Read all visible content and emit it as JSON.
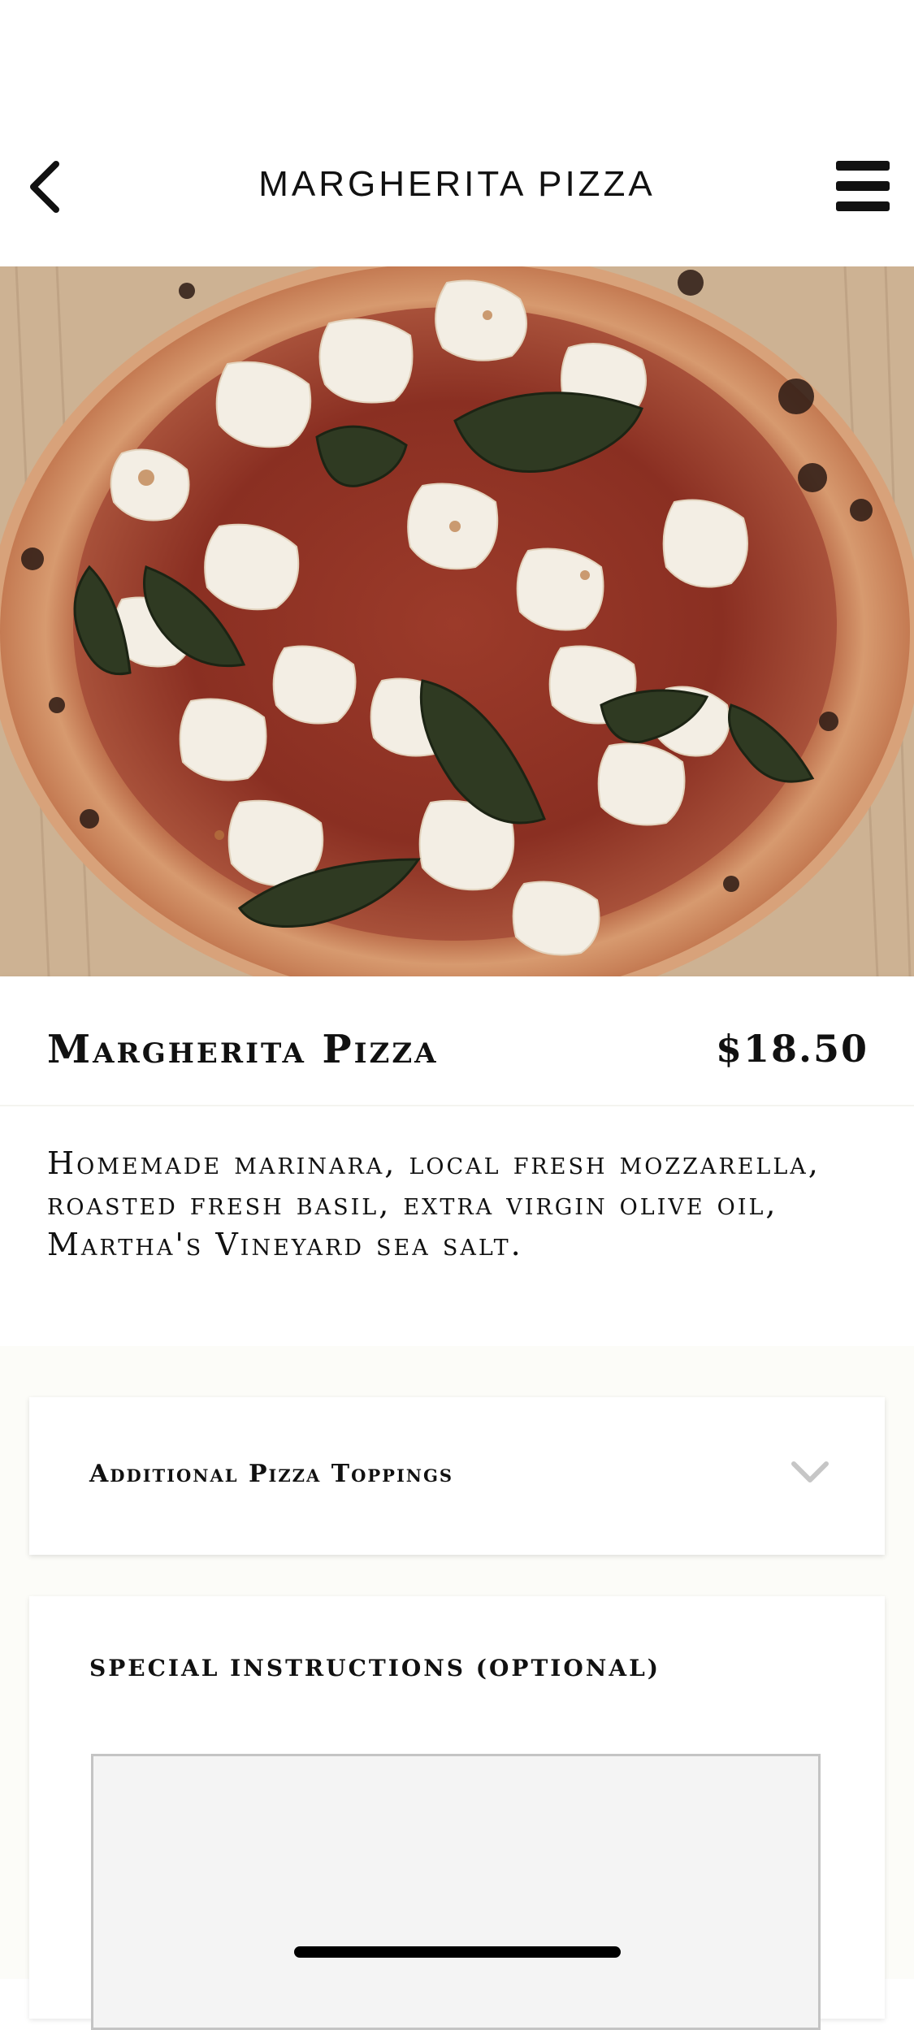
{
  "header": {
    "title": "MARGHERITA PIZZA",
    "back_icon": "chevron-left-icon",
    "menu_icon": "hamburger-menu-icon"
  },
  "hero": {
    "image": "margherita-pizza-photo"
  },
  "product": {
    "name": "Margherita Pizza",
    "price": "$18.50",
    "description": "Homemade marinara, local fresh mozzarella, roasted fresh basil, extra virgin olive oil, Martha's Vineyard sea salt."
  },
  "toppings": {
    "label": "Additional Pizza Toppings",
    "icon": "chevron-down-icon"
  },
  "instructions": {
    "label": "SPECIAL INSTRUCTIONS (OPTIONAL)",
    "value": "",
    "placeholder": ""
  },
  "colors": {
    "text": "#111111",
    "card_background": "#ffffff",
    "page_background": "#fcfcf8",
    "input_background": "#f4f4f4",
    "input_border": "#c4c4c4"
  }
}
